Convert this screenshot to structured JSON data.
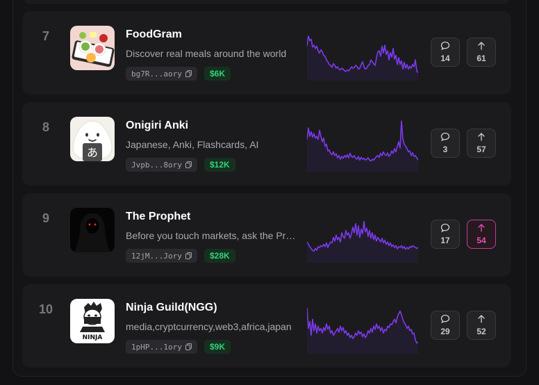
{
  "colors": {
    "accent_pink": "#e052b5",
    "sparkline": "#7c3aed",
    "mcap_green": "#33d17a"
  },
  "projects": [
    {
      "rank": "7",
      "name": "FoodGram",
      "description": "Discover real meals around the world",
      "address": "bg7R...aory",
      "market_cap": "$6K",
      "comments": "14",
      "upvotes": "61",
      "upvoted": false,
      "thumb_icon": "food-plates-icon",
      "sparkline": [
        0.6,
        0.82,
        0.72,
        0.75,
        0.58,
        0.62,
        0.55,
        0.6,
        0.5,
        0.45,
        0.52,
        0.48,
        0.4,
        0.38,
        0.3,
        0.26,
        0.2,
        0.18,
        0.14,
        0.22,
        0.18,
        0.12,
        0.15,
        0.1,
        0.08,
        0.12,
        0.1,
        0.06,
        0.05,
        0.08,
        0.06,
        0.1,
        0.15,
        0.12,
        0.14,
        0.18,
        0.16,
        0.1,
        0.12,
        0.2,
        0.26,
        0.15,
        0.1,
        0.12,
        0.18,
        0.2,
        0.3,
        0.26,
        0.22,
        0.18,
        0.34,
        0.48,
        0.5,
        0.38,
        0.6,
        0.45,
        0.62,
        0.42,
        0.5,
        0.3,
        0.46,
        0.36,
        0.55,
        0.32,
        0.4,
        0.2,
        0.35,
        0.2,
        0.28,
        0.1,
        0.25,
        0.12,
        0.2,
        0.1,
        0.16,
        0.12,
        0.2,
        0.15,
        0.3,
        0.06,
        0.02
      ]
    },
    {
      "rank": "8",
      "name": "Onigiri Anki",
      "description": "Japanese, Anki, Flashcards, AI",
      "address": "Jvpb...8ory",
      "market_cap": "$12K",
      "comments": "3",
      "upvotes": "57",
      "upvoted": false,
      "thumb_icon": "onigiri-icon",
      "sparkline": [
        0.55,
        0.8,
        0.62,
        0.72,
        0.6,
        0.68,
        0.58,
        0.62,
        0.55,
        0.75,
        0.62,
        0.5,
        0.58,
        0.4,
        0.45,
        0.3,
        0.32,
        0.25,
        0.22,
        0.28,
        0.2,
        0.24,
        0.15,
        0.2,
        0.12,
        0.18,
        0.14,
        0.2,
        0.16,
        0.22,
        0.15,
        0.25,
        0.18,
        0.16,
        0.2,
        0.14,
        0.12,
        0.18,
        0.1,
        0.16,
        0.12,
        0.14,
        0.1,
        0.12,
        0.15,
        0.1,
        0.08,
        0.12,
        0.1,
        0.14,
        0.18,
        0.2,
        0.16,
        0.25,
        0.2,
        0.28,
        0.22,
        0.2,
        0.26,
        0.18,
        0.22,
        0.3,
        0.25,
        0.35,
        0.28,
        0.4,
        0.5,
        0.36,
        0.95,
        0.55,
        0.45,
        0.4,
        0.35,
        0.28,
        0.3,
        0.2,
        0.26,
        0.18,
        0.2,
        0.15,
        0.1
      ]
    },
    {
      "rank": "9",
      "name": "The Prophet",
      "description": "Before you touch markets, ask the Prophet",
      "address": "12jM...Jory",
      "market_cap": "$28K",
      "comments": "17",
      "upvotes": "54",
      "upvoted": true,
      "thumb_icon": "hooded-prophet-icon",
      "sparkline": [
        0.3,
        0.25,
        0.2,
        0.15,
        0.12,
        0.1,
        0.16,
        0.12,
        0.2,
        0.18,
        0.22,
        0.2,
        0.25,
        0.2,
        0.28,
        0.18,
        0.25,
        0.3,
        0.28,
        0.4,
        0.32,
        0.45,
        0.35,
        0.4,
        0.3,
        0.5,
        0.42,
        0.38,
        0.55,
        0.45,
        0.5,
        0.38,
        0.48,
        0.62,
        0.5,
        0.7,
        0.45,
        0.65,
        0.4,
        0.58,
        0.48,
        0.75,
        0.52,
        0.6,
        0.42,
        0.55,
        0.38,
        0.5,
        0.35,
        0.45,
        0.32,
        0.4,
        0.35,
        0.3,
        0.38,
        0.28,
        0.34,
        0.25,
        0.3,
        0.22,
        0.28,
        0.2,
        0.24,
        0.18,
        0.22,
        0.15,
        0.2,
        0.18,
        0.22,
        0.16,
        0.2,
        0.14,
        0.18,
        0.15,
        0.2,
        0.18,
        0.22,
        0.2,
        0.18,
        0.16,
        0.18
      ]
    },
    {
      "rank": "10",
      "name": "Ninja Guild(NGG)",
      "description": "media,cryptcurrency,web3,africa,japan",
      "address": "1pHP...1ory",
      "market_cap": "$9K",
      "comments": "29",
      "upvotes": "52",
      "upvoted": false,
      "thumb_icon": "ninja-logo-icon",
      "thumb_text": "NINJA",
      "sparkline": [
        0.85,
        0.4,
        0.55,
        0.25,
        0.6,
        0.35,
        0.5,
        0.3,
        0.45,
        0.35,
        0.4,
        0.3,
        0.42,
        0.35,
        0.5,
        0.38,
        0.45,
        0.3,
        0.35,
        0.25,
        0.3,
        0.35,
        0.4,
        0.32,
        0.45,
        0.35,
        0.42,
        0.3,
        0.35,
        0.25,
        0.3,
        0.2,
        0.25,
        0.18,
        0.22,
        0.3,
        0.25,
        0.35,
        0.28,
        0.32,
        0.22,
        0.28,
        0.2,
        0.25,
        0.35,
        0.3,
        0.4,
        0.32,
        0.45,
        0.38,
        0.5,
        0.4,
        0.45,
        0.35,
        0.42,
        0.3,
        0.38,
        0.35,
        0.45,
        0.42,
        0.5,
        0.48,
        0.55,
        0.6,
        0.52,
        0.65,
        0.72,
        0.78,
        0.7,
        0.6,
        0.52,
        0.48,
        0.4,
        0.45,
        0.35,
        0.38,
        0.28,
        0.3,
        0.15,
        0.08,
        0.1
      ]
    }
  ]
}
